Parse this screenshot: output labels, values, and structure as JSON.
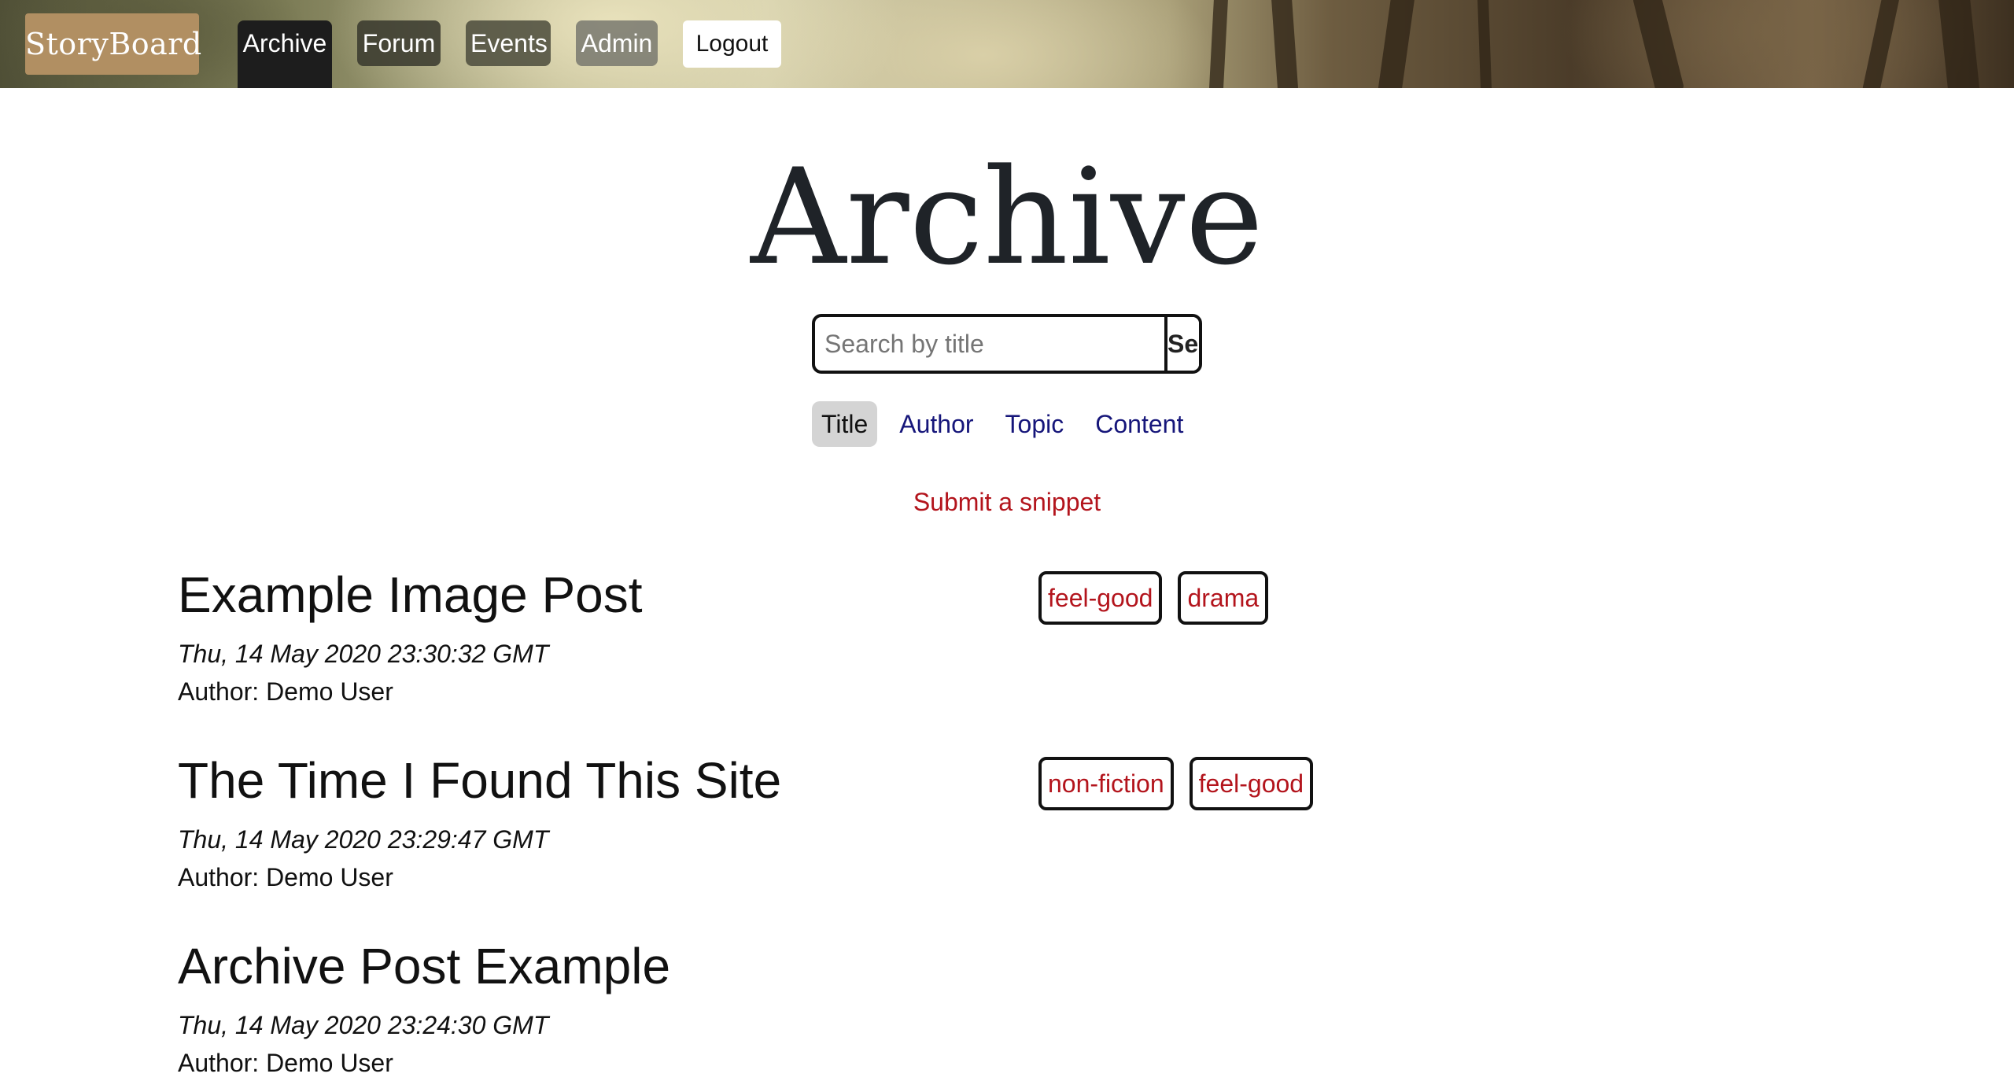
{
  "nav": {
    "brand": "StoryBoard",
    "links": [
      "Archive",
      "Forum",
      "Events",
      "Admin"
    ],
    "logout": "Logout"
  },
  "main": {
    "title": "Archive",
    "search": {
      "placeholder": "Search by title",
      "button": "Search"
    },
    "filters": [
      "Title",
      "Author",
      "Topic",
      "Content"
    ],
    "active_filter": "Title",
    "submit_link": "Submit a snippet"
  },
  "posts": [
    {
      "title": "Example Image Post",
      "date": "Thu, 14 May 2020 23:30:32 GMT",
      "author": "Author: Demo User",
      "tags": [
        "feel-good",
        "drama"
      ]
    },
    {
      "title": "The Time I Found This Site",
      "date": "Thu, 14 May 2020 23:29:47 GMT",
      "author": "Author: Demo User",
      "tags": [
        "non-fiction",
        "feel-good"
      ]
    },
    {
      "title": "Archive Post Example",
      "date": "Thu, 14 May 2020 23:24:30 GMT",
      "author": "Author: Demo User",
      "tags": []
    }
  ],
  "colors": {
    "brand_bg": "#b18f62",
    "link_blue": "#16167a",
    "accent_red": "#b3141c",
    "active_filter_bg": "#d4d4d4"
  }
}
